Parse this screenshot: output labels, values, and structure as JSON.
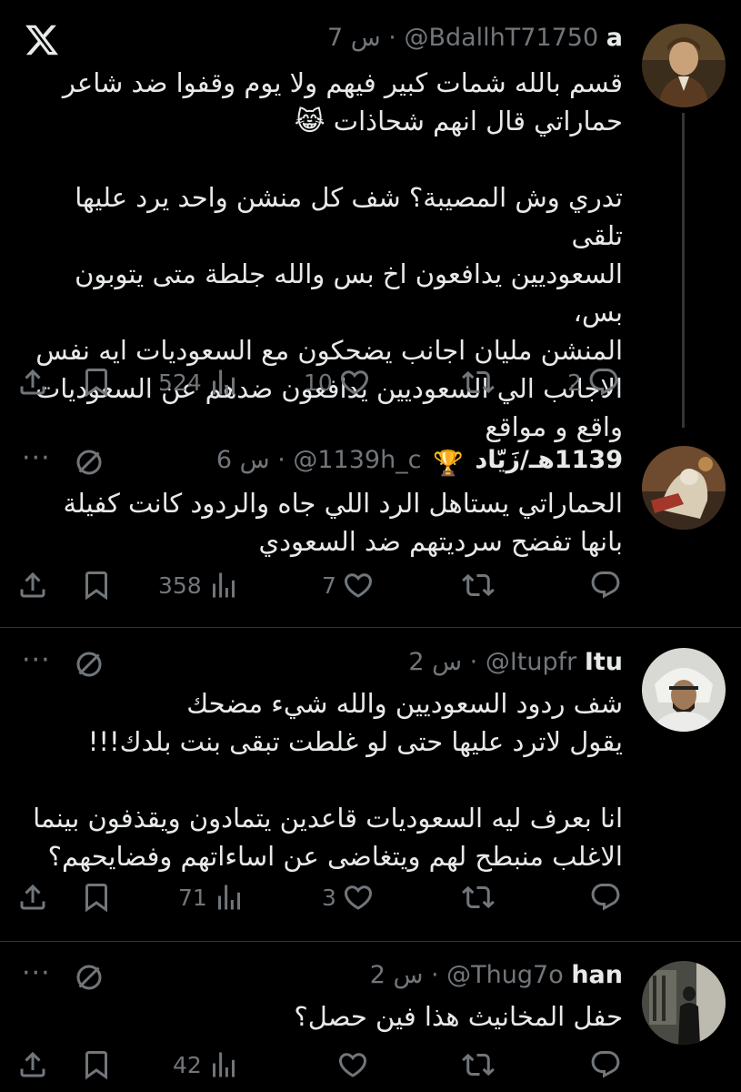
{
  "tweets": [
    {
      "name": "a",
      "handle": "@BdallhT71750",
      "time": "7 س",
      "lines": [
        "قسم بالله شمات كبير فيهم ولا يوم وقفوا ضد شاعر",
        "حماراتي قال انهم شحاذات 😹",
        "",
        "تدري وش المصيبة؟ شف كل منشن واحد يرد عليها تلقى",
        "السعوديين يدافعون اخ بس والله جلطة متى يتوبون بس،",
        "المنشن مليان اجانب يضحكون مع السعوديات ايه نفس",
        "الاجانب الي السعوديين يدافعون ضدهم عن السعوديات",
        "واقع و مواقع"
      ],
      "replies": "2",
      "reposts": "",
      "likes": "10",
      "views": "524"
    },
    {
      "name": "1139هـ/زَيّاد",
      "badge": "🏆",
      "handle": "@1139h_c",
      "time": "6 س",
      "lines": [
        "الحماراتي يستاهل الرد اللي جاه والردود كانت كفيلة",
        "بانها تفضح سرديتهم ضد السعودي"
      ],
      "replies": "",
      "reposts": "",
      "likes": "7",
      "views": "358"
    },
    {
      "name": "Itu",
      "handle": "@Itupfr",
      "time": "2 س",
      "lines": [
        "شف ردود السعوديين والله شيء مضحك",
        "يقول لاترد عليها حتى لو غلطت تبقى بنت بلدك!!!",
        "",
        "انا بعرف ليه السعوديات قاعدين يتمادون ويقذفون بينما",
        "الاغلب منبطح لهم ويتغاضى عن اساءاتهم وفضايحهم؟"
      ],
      "replies": "",
      "reposts": "",
      "likes": "3",
      "views": "71"
    },
    {
      "name": "han",
      "handle": "@Thug7o",
      "time": "2 س",
      "lines": [
        "حفل المخانيث هذا فين حصل؟"
      ],
      "replies": "",
      "reposts": "",
      "likes": "",
      "views": "42"
    }
  ],
  "icons": {
    "logo": "x-logo-icon",
    "reply": "reply-icon",
    "repost": "repost-icon",
    "like": "heart-icon",
    "views": "views-icon",
    "bookmark": "bookmark-icon",
    "share": "share-icon",
    "grok": "grok-icon",
    "more": "more-icon"
  },
  "colors": {
    "background": "#000000",
    "text": "#e7e9ea",
    "muted": "#71767b",
    "divider": "#2f3336"
  }
}
